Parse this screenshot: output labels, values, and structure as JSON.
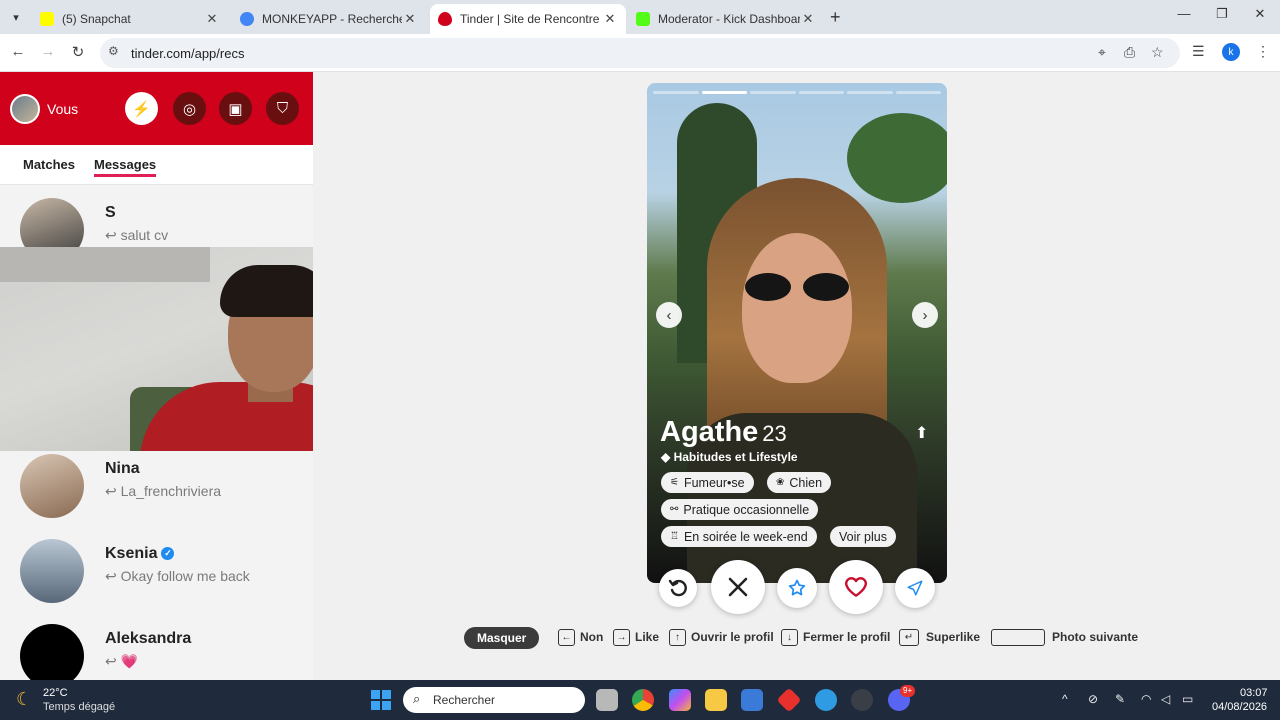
{
  "browser": {
    "tabs": [
      {
        "title": "(5) Snapchat",
        "favicon_color": "#fffc00"
      },
      {
        "title": "MONKEYAPP - Recherche Google",
        "favicon_color": "#4285f4"
      },
      {
        "title": "Tinder | Site de Rencontre",
        "favicon_color": "#fe3c72"
      },
      {
        "title": "Moderator - Kick Dashboard",
        "favicon_color": "#53fc18"
      }
    ],
    "url": "tinder.com/app/recs",
    "profile_initial": "k"
  },
  "sidebar": {
    "user_label": "Vous",
    "tabs": [
      "Matches",
      "Messages"
    ],
    "conversations": [
      {
        "name": "S",
        "preview": "salut cv"
      },
      {
        "name": "Nina",
        "preview": "La_frenchriviera"
      },
      {
        "name": "Ksenia",
        "preview": "Okay follow me back",
        "verified": true
      },
      {
        "name": "Aleksandra",
        "preview": "💗"
      }
    ]
  },
  "profile_card": {
    "name": "Agathe",
    "age": "23",
    "section": "Habitudes et Lifestyle",
    "chips": [
      "Fumeur•se",
      "Chien",
      "Pratique occasionnelle",
      "En soirée le week-end"
    ],
    "more": "Voir plus",
    "photo_count": 6,
    "current_photo": 2
  },
  "shortcuts": {
    "hide": "Masquer",
    "no": "Non",
    "like": "Like",
    "open_profile": "Ouvrir le profil",
    "close_profile": "Fermer le profil",
    "superlike": "Superlike",
    "next_photo": "Photo suivante"
  },
  "taskbar": {
    "temperature": "22°C",
    "weather": "Temps dégagé",
    "search_placeholder": "Rechercher",
    "time": "03:07",
    "date": "04/08/2026",
    "discord_badge": "9+"
  },
  "colors": {
    "tinder_red": "#d0011b",
    "nope": "#222222",
    "like": "#c8102e",
    "superlike": "#1d8bf1"
  }
}
